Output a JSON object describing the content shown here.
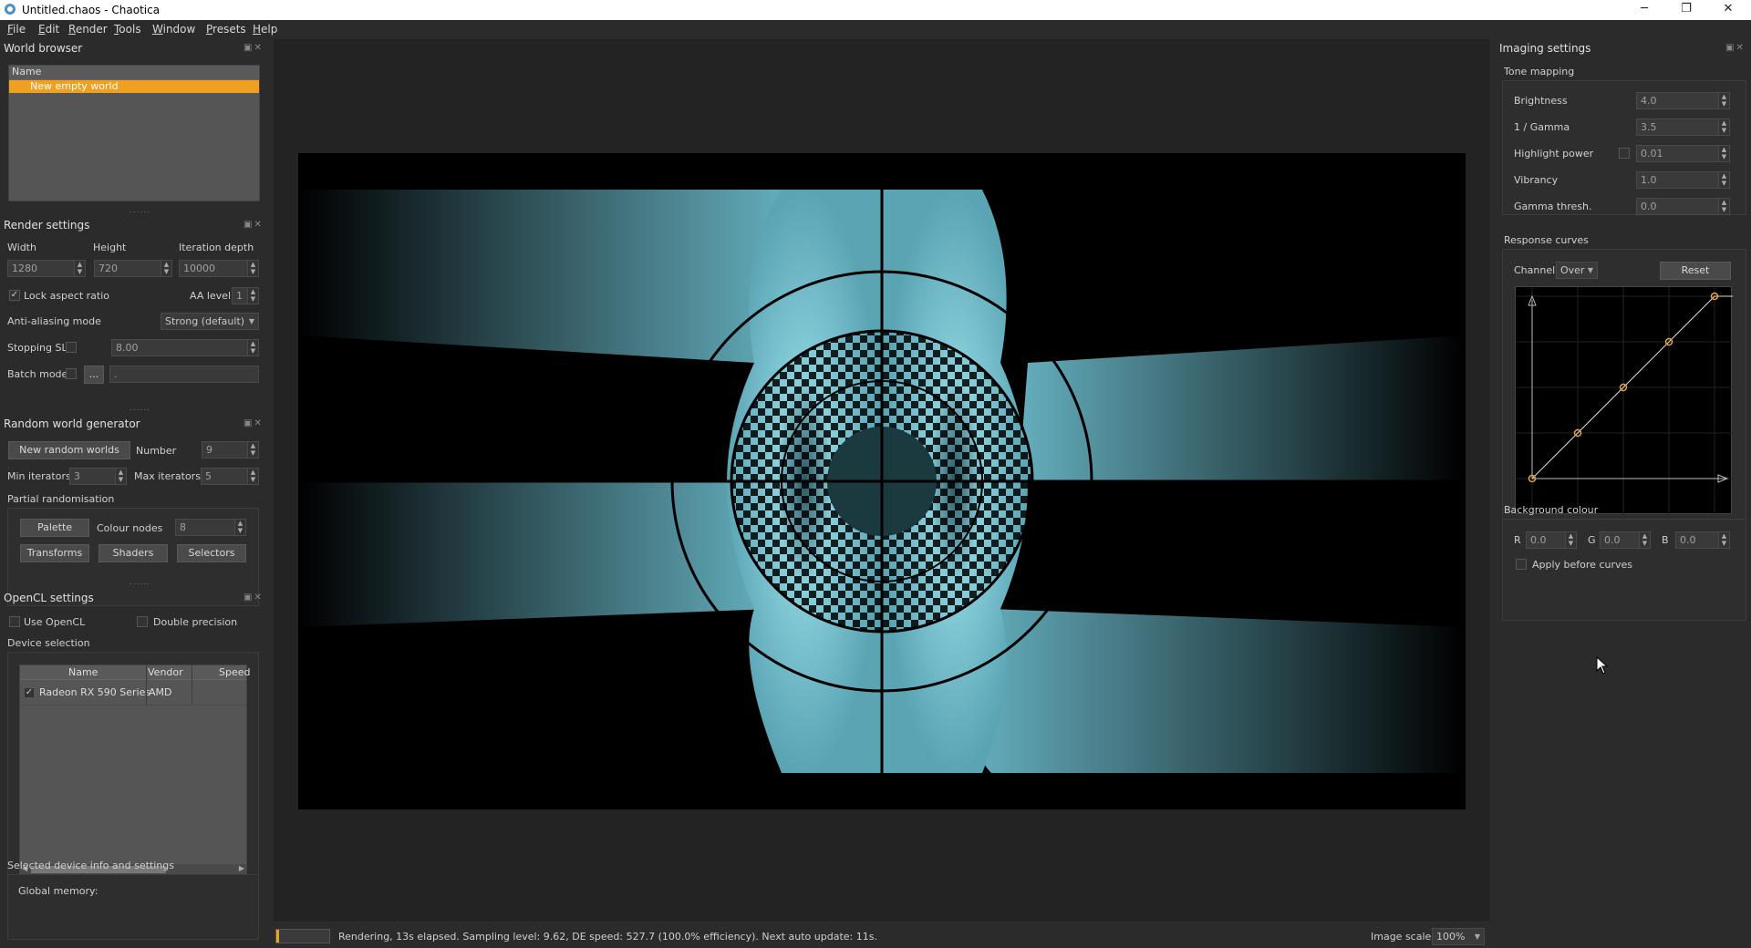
{
  "window": {
    "title": "Untitled.chaos - Chaotica",
    "minimize": "─",
    "maximize": "❐",
    "close": "✕"
  },
  "menu": [
    "File",
    "Edit",
    "Render",
    "Tools",
    "Window",
    "Presets",
    "Help"
  ],
  "world_browser": {
    "title": "World browser",
    "col_name": "Name",
    "items": [
      "New empty world"
    ]
  },
  "render_settings": {
    "title": "Render settings",
    "width_label": "Width",
    "height_label": "Height",
    "iter_label": "Iteration depth",
    "width": "1280",
    "height": "720",
    "iter": "10000",
    "lock_aspect": "Lock aspect ratio",
    "aa_level_label": "AA level",
    "aa_level": "1",
    "aa_mode_label": "Anti-aliasing mode",
    "aa_mode": "Strong (default)",
    "stopping_label": "Stopping SL",
    "stopping_value": "8.00",
    "batch_label": "Batch mode",
    "batch_btn": "...",
    "batch_path": "."
  },
  "random_gen": {
    "title": "Random world generator",
    "new_btn": "New random worlds",
    "number_label": "Number",
    "number": "9",
    "min_label": "Min iterators",
    "min": "3",
    "max_label": "Max iterators",
    "max": "5",
    "partial": "Partial randomisation",
    "palette_btn": "Palette",
    "colour_nodes_label": "Colour nodes",
    "colour_nodes": "8",
    "transforms_btn": "Transforms",
    "shaders_btn": "Shaders",
    "selectors_btn": "Selectors"
  },
  "opencl": {
    "title": "OpenCL settings",
    "use_label": "Use OpenCL",
    "double_label": "Double precision",
    "device_selection": "Device selection",
    "col_name": "Name",
    "col_vendor": "Vendor",
    "col_speed": "Speed",
    "devices": [
      {
        "name": "Radeon RX 590 Series",
        "vendor": "AMD",
        "speed": ""
      }
    ],
    "info_title": "Selected device info and settings",
    "global_memory": "Global memory:"
  },
  "imaging": {
    "title": "Imaging settings",
    "tone_mapping": "Tone mapping",
    "brightness_label": "Brightness",
    "brightness": "4.0",
    "gamma_label": "1 / Gamma",
    "gamma": "3.5",
    "highlight_label": "Highlight power",
    "highlight": "0.01",
    "vibrancy_label": "Vibrancy",
    "vibrancy": "1.0",
    "gamma_thresh_label": "Gamma thresh.",
    "gamma_thresh": "0.0",
    "response_curves": "Response curves",
    "channel_label": "Channel:",
    "channel": "Over",
    "reset_btn": "Reset",
    "curve_points": [
      [
        0,
        0
      ],
      [
        0.25,
        0.25
      ],
      [
        0.5,
        0.5
      ],
      [
        0.75,
        0.75
      ],
      [
        1,
        1
      ]
    ],
    "background_colour": "Background colour",
    "r_label": "R",
    "r": "0.0",
    "g_label": "G",
    "g": "0.0",
    "b_label": "B",
    "b": "0.0",
    "apply_before": "Apply before curves"
  },
  "status": {
    "text": "Rendering, 13s elapsed. Sampling level: 9.62, DE speed: 527.7 (100.0% efficiency). Next auto update: 11s.",
    "scale_label": "Image scale:",
    "scale": "100%"
  },
  "colors": {
    "accent": "#f0a020",
    "fractal": "#6ab8c8",
    "curve": "#e8a040"
  }
}
